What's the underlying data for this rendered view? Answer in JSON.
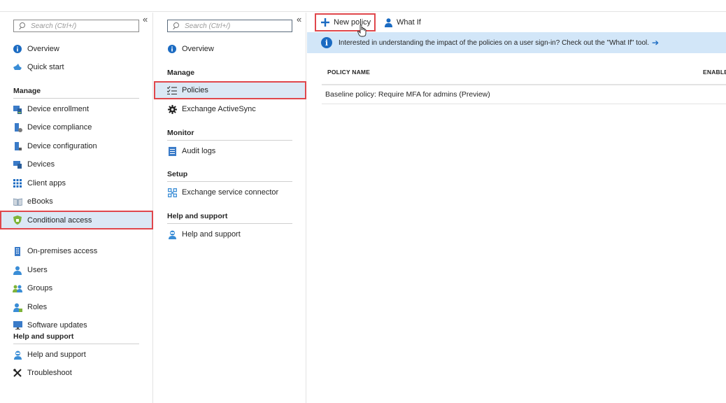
{
  "left_nav": {
    "collapse_glyph": "«",
    "search_placeholder": "Search (Ctrl+/)",
    "items": [
      {
        "label": "Overview",
        "icon": "info-icon"
      },
      {
        "label": "Quick start",
        "icon": "cloud-icon"
      },
      {
        "label": "Device enrollment",
        "icon": "device-enrollment-icon"
      },
      {
        "label": "Device compliance",
        "icon": "device-compliance-icon"
      },
      {
        "label": "Device configuration",
        "icon": "device-configuration-icon"
      },
      {
        "label": "Devices",
        "icon": "devices-icon"
      },
      {
        "label": "Client apps",
        "icon": "grid-icon"
      },
      {
        "label": "eBooks",
        "icon": "book-icon"
      },
      {
        "label": "Conditional access",
        "icon": "shield-icon"
      },
      {
        "label": "On-premises access",
        "icon": "building-icon"
      },
      {
        "label": "Users",
        "icon": "user-icon"
      },
      {
        "label": "Groups",
        "icon": "group-icon"
      },
      {
        "label": "Roles",
        "icon": "role-icon"
      },
      {
        "label": "Software updates",
        "icon": "monitor-icon"
      },
      {
        "label": "Help and support",
        "icon": "support-icon"
      },
      {
        "label": "Troubleshoot",
        "icon": "tools-icon"
      }
    ],
    "sections": {
      "manage": "Manage",
      "help": "Help and support"
    }
  },
  "mid_nav": {
    "collapse_glyph": "«",
    "search_placeholder": "Search (Ctrl+/)",
    "items": [
      {
        "label": "Overview",
        "icon": "info-icon"
      },
      {
        "label": "Policies",
        "icon": "checklist-icon"
      },
      {
        "label": "Exchange ActiveSync",
        "icon": "gear-icon"
      },
      {
        "label": "Audit logs",
        "icon": "log-book-icon"
      },
      {
        "label": "Exchange service connector",
        "icon": "connector-icon"
      },
      {
        "label": "Help and support",
        "icon": "support-icon"
      }
    ],
    "sections": {
      "manage": "Manage",
      "monitor": "Monitor",
      "setup": "Setup",
      "help": "Help and support"
    }
  },
  "toolbar": {
    "new_policy": "New policy",
    "what_if": "What If"
  },
  "banner": {
    "text": "Interested in understanding the impact of the policies on a user sign-in? Check out the \"What If\" tool.",
    "arrow": "➔"
  },
  "table": {
    "columns": [
      "POLICY NAME",
      "ENABLED"
    ],
    "rows": [
      {
        "name": "Baseline policy: Require MFA for admins (Preview)"
      }
    ]
  },
  "colors": {
    "accent": "#1b6bc2",
    "highlight_border": "#e0474c",
    "selected_bg": "#dbe8f5",
    "banner_bg": "#d2e6f8"
  }
}
